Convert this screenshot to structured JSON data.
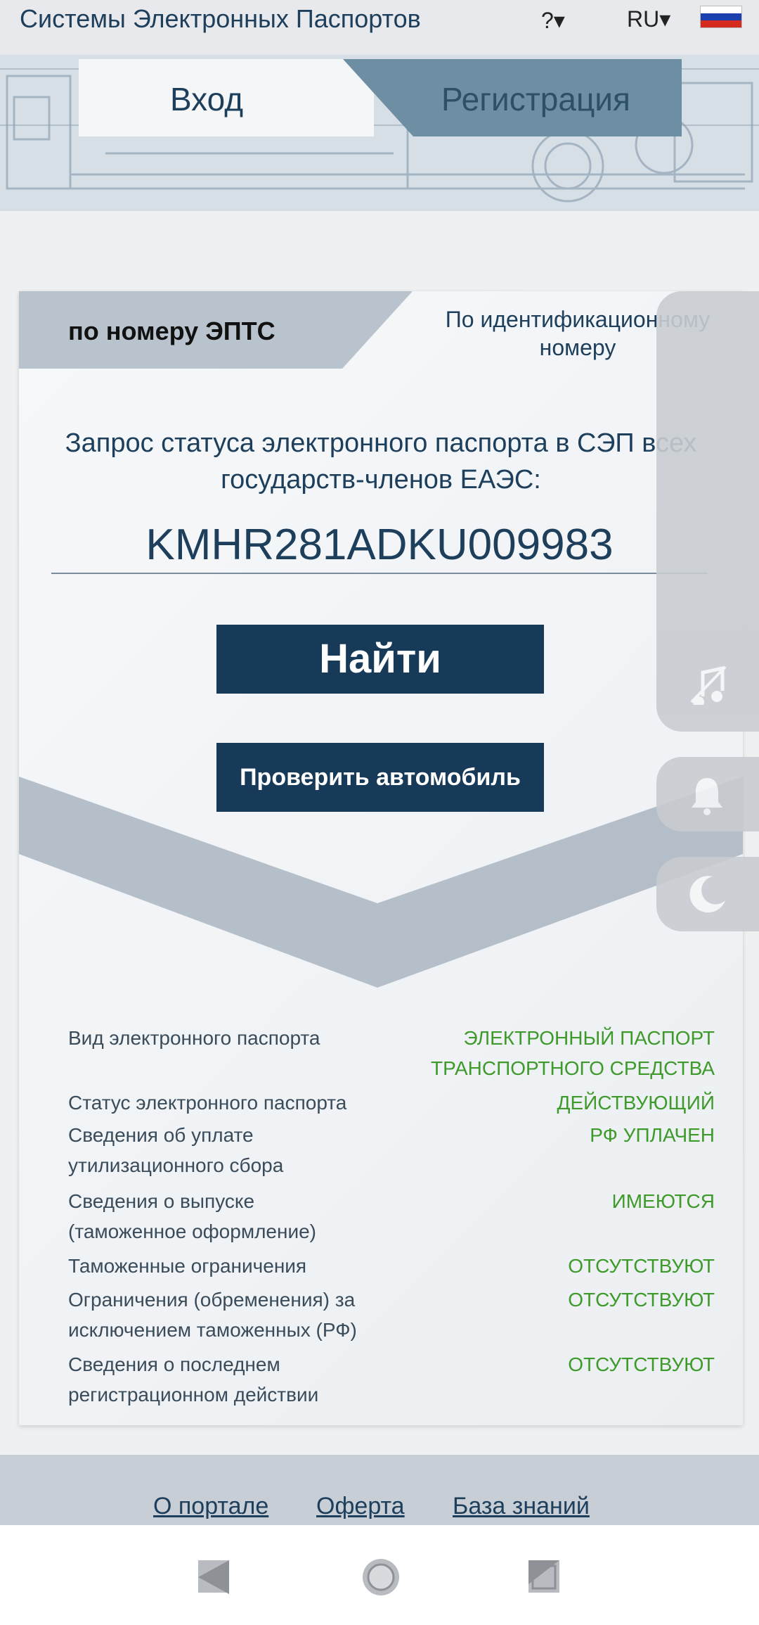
{
  "header": {
    "brand": "Системы Электронных Паспортов",
    "help_label": "?▾",
    "lang_label": "RU▾",
    "flag_colors": [
      "#ffffff",
      "#1c3fb0",
      "#d52b1e"
    ]
  },
  "tabs": {
    "login": "Вход",
    "register": "Регистрация"
  },
  "subtabs": {
    "by_number": "по номеру ЭПТС",
    "by_id": "По идентификационному номеру"
  },
  "query": {
    "text": "Запрос статуса электронного паспорта в СЭП всех государств-членов ЕАЭС:",
    "vin_value": "KMHR281ADKU009983"
  },
  "buttons": {
    "find": "Найти",
    "check_car": "Проверить автомобиль"
  },
  "results": [
    {
      "label": "Вид электронного паспорта",
      "value": "ЭЛЕКТРОННЫЙ ПАСПОРТ ТРАНСПОРТНОГО СРЕДСТВА"
    },
    {
      "label": "Статус электронного паспорта",
      "value": "ДЕЙСТВУЮЩИЙ"
    },
    {
      "label": "Сведения об уплате утилизационного сбора",
      "value": "РФ УПЛАЧЕН"
    },
    {
      "label": "Сведения о выпуске (таможенное оформление)",
      "value": "ИМЕЮТСЯ"
    },
    {
      "label": "Таможенные ограничения",
      "value": "ОТСУТСТВУЮТ"
    },
    {
      "label": "Ограничения (обременения) за исключением таможенных (РФ)",
      "value": "ОТСУТСТВУЮТ"
    },
    {
      "label": "Сведения о последнем регистрационном действии",
      "value": "ОТСУТСТВУЮТ"
    }
  ],
  "footer": {
    "about": "О портале",
    "offer": "Оферта",
    "knowledge": "База знаний"
  },
  "colors": {
    "primary": "#173a59",
    "status_green": "#3e9a2a"
  }
}
